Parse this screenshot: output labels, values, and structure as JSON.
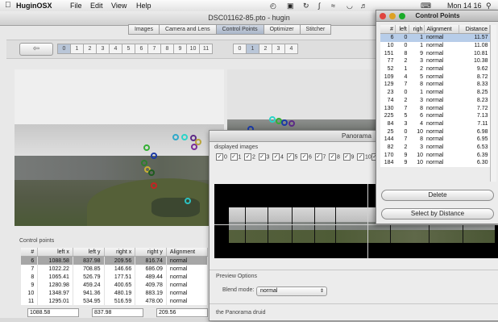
{
  "menubar": {
    "app_name": "HuginOSX",
    "menus": [
      "File",
      "Edit",
      "View",
      "Help"
    ],
    "clock": "Mon 14 16",
    "apple_glyph": "",
    "icons": [
      "clock-icon",
      "bluetooth-icon",
      "wifi-icon",
      "volume-icon",
      "sync-icon",
      "script-icon",
      "keyboard-icon",
      "spotlight-icon"
    ]
  },
  "window": {
    "title": "DSC01162-85.pto - hugin",
    "tabs": [
      "Images",
      "Camera and Lens",
      "Control Points",
      "Optimizer",
      "Stitcher"
    ],
    "active_tab": "Control Points",
    "left_numbers": [
      "0",
      "1",
      "2",
      "3",
      "4",
      "5",
      "6",
      "7",
      "8",
      "9",
      "10",
      "11"
    ],
    "right_numbers": [
      "0",
      "1",
      "2",
      "3",
      "4"
    ],
    "left_selected": "0",
    "right_selected": "1"
  },
  "control_points_section": {
    "label": "Control points",
    "columns": [
      "#",
      "left x",
      "left y",
      "right x",
      "right y",
      "Alignment"
    ],
    "rows": [
      [
        "6",
        "1088.58",
        "837.98",
        "209.56",
        "816.74",
        "normal"
      ],
      [
        "7",
        "1022.22",
        "708.85",
        "146.66",
        "686.09",
        "normal"
      ],
      [
        "8",
        "1065.41",
        "526.79",
        "177.51",
        "489.44",
        "normal"
      ],
      [
        "9",
        "1280.98",
        "459.24",
        "400.65",
        "409.78",
        "normal"
      ],
      [
        "10",
        "1348.97",
        "941.36",
        "480.19",
        "883.19",
        "normal"
      ],
      [
        "11",
        "1295.01",
        "534.95",
        "516.59",
        "478.00",
        "normal"
      ]
    ],
    "selected_row": 0,
    "fields": [
      "1088.58",
      "837.98",
      "209.56"
    ]
  },
  "preview": {
    "title": "Panorama",
    "displayed_label": "displayed images",
    "image_numbers": [
      "0",
      "1",
      "2",
      "3",
      "4",
      "5",
      "6",
      "7",
      "8",
      "9",
      "10",
      "11"
    ],
    "options_label": "Preview Options",
    "blend_label": "Blend mode:",
    "blend_value": "normal",
    "druid_label": "the Panorama druid"
  },
  "cp_panel": {
    "title": "Control Points",
    "columns": [
      "#",
      "left",
      "righ",
      "Alignment",
      "Distance"
    ],
    "rows": [
      [
        "6",
        "0",
        "1",
        "normal",
        "11.57"
      ],
      [
        "10",
        "0",
        "1",
        "normal",
        "11.08"
      ],
      [
        "151",
        "8",
        "9",
        "normal",
        "10.81"
      ],
      [
        "77",
        "2",
        "3",
        "normal",
        "10.38"
      ],
      [
        "52",
        "1",
        "2",
        "normal",
        "9.62"
      ],
      [
        "109",
        "4",
        "5",
        "normal",
        "8.72"
      ],
      [
        "129",
        "7",
        "8",
        "normal",
        "8.33"
      ],
      [
        "23",
        "0",
        "1",
        "normal",
        "8.25"
      ],
      [
        "74",
        "2",
        "3",
        "normal",
        "8.23"
      ],
      [
        "130",
        "7",
        "8",
        "normal",
        "7.72"
      ],
      [
        "225",
        "5",
        "6",
        "normal",
        "7.13"
      ],
      [
        "84",
        "3",
        "4",
        "normal",
        "7.11"
      ],
      [
        "25",
        "0",
        "10",
        "normal",
        "6.98"
      ],
      [
        "144",
        "7",
        "8",
        "normal",
        "6.95"
      ],
      [
        "82",
        "2",
        "3",
        "normal",
        "6.53"
      ],
      [
        "170",
        "9",
        "10",
        "normal",
        "6.39"
      ],
      [
        "184",
        "9",
        "10",
        "normal",
        "6.30"
      ]
    ],
    "selected_row": 0,
    "delete_label": "Delete",
    "select_label": "Select by Distance"
  },
  "colors": {
    "selection_blue": "#b7cde9",
    "selection_gray": "#a6a6a6",
    "traffic_red": "#e0443e",
    "traffic_yellow": "#dea123",
    "traffic_green": "#1aab29"
  }
}
